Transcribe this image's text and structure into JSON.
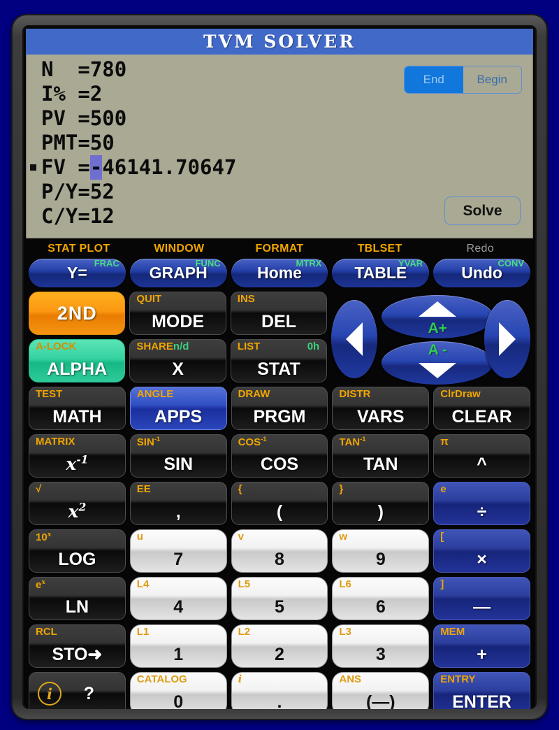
{
  "screen": {
    "title": "TVM SOLVER",
    "rows": [
      {
        "key": "N  ",
        "eq": "=",
        "value": "780",
        "marker": false
      },
      {
        "key": "I% ",
        "eq": "=",
        "value": "2",
        "marker": false
      },
      {
        "key": "PV ",
        "eq": "=",
        "value": "500",
        "marker": false
      },
      {
        "key": "PMT",
        "eq": "=",
        "value": "50",
        "marker": false
      },
      {
        "key": "FV ",
        "eq": "=",
        "value": "-46141.70647",
        "marker": true,
        "cursor_char": "-",
        "rest": "46141.70647"
      },
      {
        "key": "P/Y",
        "eq": "=",
        "value": "52",
        "marker": false
      },
      {
        "key": "C/Y",
        "eq": "=",
        "value": "12",
        "marker": false
      }
    ],
    "payment_toggle": {
      "selected": "End",
      "options": [
        "End",
        "Begin"
      ]
    },
    "solve_label": "Solve"
  },
  "top_labels": [
    {
      "text": "STAT PLOT",
      "style": "orange"
    },
    {
      "text": "WINDOW",
      "style": "orange"
    },
    {
      "text": "FORMAT",
      "style": "orange"
    },
    {
      "text": "TBLSET",
      "style": "orange"
    },
    {
      "text": "Redo",
      "style": "gray"
    }
  ],
  "top_keys": [
    {
      "main": "Y=",
      "alt": "FRAC"
    },
    {
      "main": "GRAPH",
      "alt": "FUNC"
    },
    {
      "main": "Home",
      "alt": "MTRX"
    },
    {
      "main": "TABLE",
      "alt": "YVAR"
    },
    {
      "main": "Undo",
      "alt": "CONV"
    }
  ],
  "pad_left": [
    {
      "main": "2ND",
      "sec": "",
      "style": "orange"
    },
    {
      "main": "MODE",
      "sec": "QUIT",
      "style": "dark"
    },
    {
      "main": "DEL",
      "sec": "INS",
      "style": "dark"
    },
    {
      "main": "ALPHA",
      "sec": "A-LOCK",
      "style": "green"
    },
    {
      "main": "X",
      "sec": "SHARE",
      "sec_green": "n/d",
      "style": "dark"
    },
    {
      "main": "STAT",
      "sec": "LIST",
      "sec_right": "0h",
      "style": "dark"
    }
  ],
  "arrow_pad": {
    "left": {
      "icon": "arrow-left-icon"
    },
    "right": {
      "icon": "arrow-right-icon"
    },
    "up": {
      "icon": "arrow-up-icon",
      "label": "A+"
    },
    "down": {
      "icon": "arrow-down-icon",
      "label": "A -"
    }
  },
  "rows": [
    [
      {
        "main": "MATH",
        "sec": "TEST",
        "style": "dark"
      },
      {
        "main": "APPS",
        "sec": "ANGLE",
        "style": "bluehl"
      },
      {
        "main": "PRGM",
        "sec": "DRAW",
        "style": "dark"
      },
      {
        "main": "VARS",
        "sec": "DISTR",
        "style": "dark"
      },
      {
        "main": "CLEAR",
        "sec": "ClrDraw",
        "style": "dark"
      }
    ],
    [
      {
        "main": "x⁻¹",
        "main_html": "x-inv",
        "sec": "MATRIX",
        "style": "dark"
      },
      {
        "main": "SIN",
        "sec": "SIN⁻¹",
        "sec_html": "sin-inv",
        "style": "dark"
      },
      {
        "main": "COS",
        "sec": "COS⁻¹",
        "sec_html": "cos-inv",
        "style": "dark"
      },
      {
        "main": "TAN",
        "sec": "TAN⁻¹",
        "sec_html": "tan-inv",
        "style": "dark"
      },
      {
        "main": "^",
        "sec": "π",
        "style": "dark"
      }
    ],
    [
      {
        "main": "x²",
        "main_html": "x-sq",
        "sec": "√",
        "style": "dark"
      },
      {
        "main": ",",
        "sec": "EE",
        "style": "dark"
      },
      {
        "main": "(",
        "sec": "{",
        "style": "dark"
      },
      {
        "main": ")",
        "sec": "}",
        "style": "dark"
      },
      {
        "main": "÷",
        "sec": "e",
        "style": "blue"
      }
    ],
    [
      {
        "main": "LOG",
        "sec": "10ˣ",
        "sec_html": "ten-x",
        "style": "dark"
      },
      {
        "main": "7",
        "sec": "u",
        "style": "white"
      },
      {
        "main": "8",
        "sec": "v",
        "style": "white"
      },
      {
        "main": "9",
        "sec": "w",
        "style": "white"
      },
      {
        "main": "×",
        "sec": "[",
        "style": "blue"
      }
    ],
    [
      {
        "main": "LN",
        "sec": "eˣ",
        "sec_html": "e-x",
        "style": "dark"
      },
      {
        "main": "4",
        "sec": "L4",
        "style": "white"
      },
      {
        "main": "5",
        "sec": "L5",
        "style": "white"
      },
      {
        "main": "6",
        "sec": "L6",
        "style": "white"
      },
      {
        "main": "—",
        "sec": "]",
        "style": "blue"
      }
    ],
    [
      {
        "main": "STO➜",
        "sec": "RCL",
        "style": "dark"
      },
      {
        "main": "1",
        "sec": "L1",
        "style": "white"
      },
      {
        "main": "2",
        "sec": "L2",
        "style": "white"
      },
      {
        "main": "3",
        "sec": "L3",
        "style": "white"
      },
      {
        "main": "+",
        "sec": "MEM",
        "style": "blue"
      }
    ],
    [
      {
        "main": "?",
        "sec": "",
        "style": "dark",
        "info_icon": true
      },
      {
        "main": "0",
        "sec": "CATALOG",
        "style": "white"
      },
      {
        "main": ".",
        "sec": "i",
        "sec_italic": true,
        "style": "white"
      },
      {
        "main": "(—)",
        "sec": "ANS",
        "style": "white"
      },
      {
        "main": "ENTER",
        "sec": "ENTRY",
        "style": "blue"
      }
    ]
  ],
  "colors": {
    "frame": "#333333",
    "background": "#000080",
    "screen_bg": "#a9a994",
    "screen_title_bg": "#4169c8",
    "second_orange": "#f0a500",
    "alpha_green": "#3fd07d",
    "blue_key": "#2c3f9e",
    "accent_blue": "#1177dd"
  }
}
